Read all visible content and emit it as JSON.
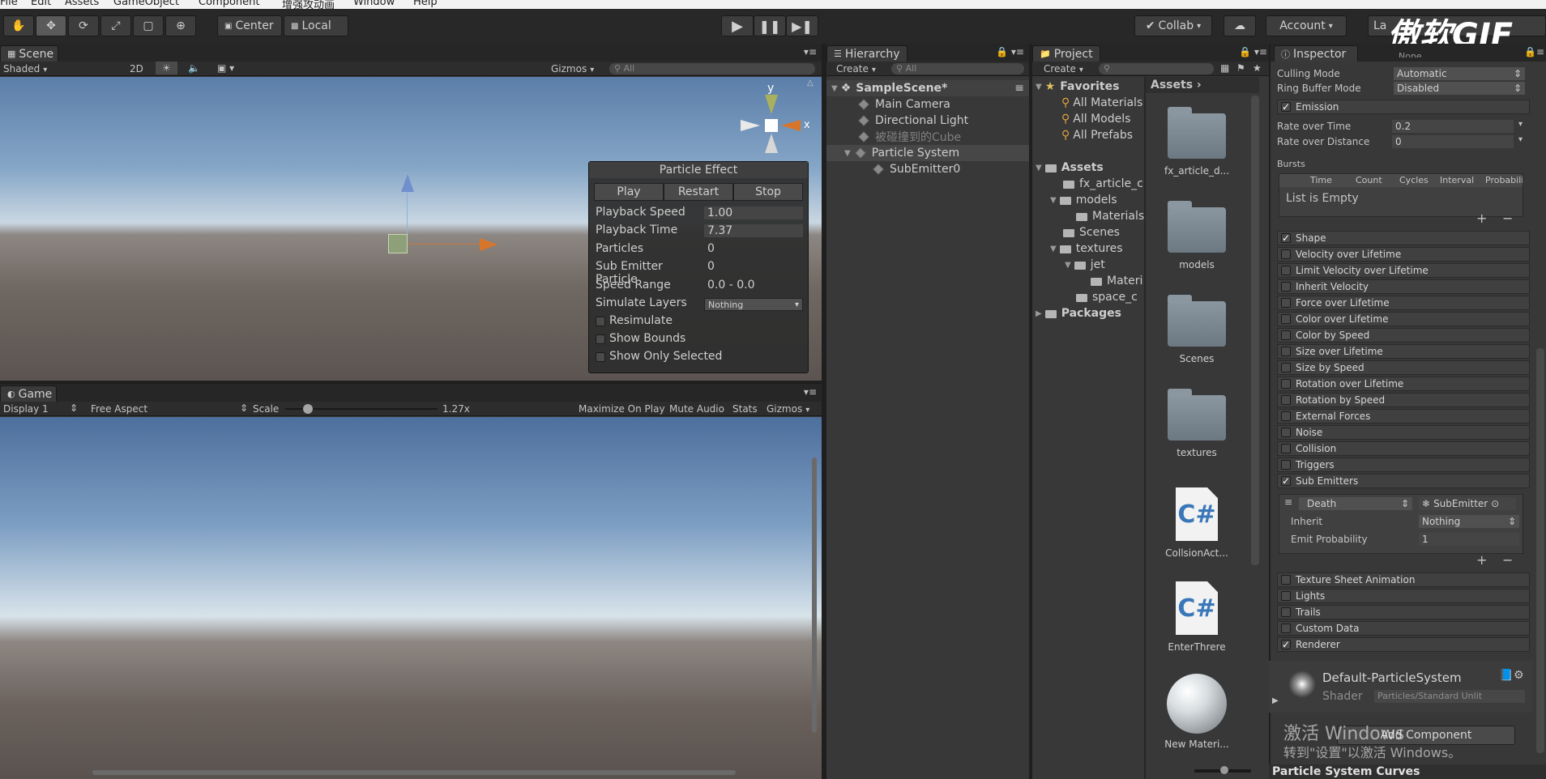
{
  "menu": [
    "File",
    "Edit",
    "Assets",
    "GameObject",
    "Component",
    "增强攻动画",
    "Window",
    "Help"
  ],
  "toolbar": {
    "pivot": "Center",
    "space": "Local",
    "collab": "Collab",
    "account": "Account",
    "layers": "La"
  },
  "watermark": "傲软GIF",
  "scene": {
    "tab": "Scene",
    "shading": "Shaded",
    "mode2d": "2D",
    "gizmos": "Gizmos",
    "search_placeholder": "All",
    "axis_y": "y",
    "axis_x": "x"
  },
  "particle_effect": {
    "title": "Particle Effect",
    "play": "Play",
    "restart": "Restart",
    "stop": "Stop",
    "rows": [
      {
        "label": "Playback Speed",
        "value": "1.00"
      },
      {
        "label": "Playback Time",
        "value": "7.37"
      },
      {
        "label": "Particles",
        "value": "0"
      },
      {
        "label": "Sub Emitter Particle",
        "value": "0"
      },
      {
        "label": "Speed Range",
        "value": "0.0 - 0.0"
      }
    ],
    "simulate_label": "Simulate Layers",
    "simulate_value": "Nothing",
    "resimulate": "Resimulate",
    "show_bounds": "Show Bounds",
    "show_only_selected": "Show Only Selected"
  },
  "game": {
    "tab": "Game",
    "display": "Display 1",
    "aspect": "Free Aspect",
    "scale_label": "Scale",
    "scale_value": "1.27x",
    "scale_fraction": 0.15,
    "maximize": "Maximize On Play",
    "mute": "Mute Audio",
    "stats": "Stats",
    "gizmos": "Gizmos"
  },
  "hierarchy": {
    "tab": "Hierarchy",
    "create": "Create",
    "search_placeholder": "All",
    "scene": "SampleScene*",
    "items": [
      "Main Camera",
      "Directional Light",
      "被碰撞到的Cube",
      "Particle System",
      "SubEmitter0"
    ]
  },
  "project": {
    "tab": "Project",
    "create": "Create",
    "favorites": "Favorites",
    "fav_items": [
      "All Materials",
      "All Models",
      "All Prefabs"
    ],
    "assets_root": "Assets",
    "tree": [
      "fx_article_c",
      "models",
      "Materials",
      "Scenes",
      "textures",
      "jet",
      "Materi",
      "space_c"
    ],
    "packages": "Packages",
    "breadcrumb": "Assets",
    "grid": [
      "fx_article_d...",
      "models",
      "Scenes",
      "textures",
      "CollsionAct...",
      "EnterThrere",
      "New Materi..."
    ],
    "cs_glyph": "C#"
  },
  "inspector": {
    "tab": "Inspector",
    "top_cut": "None",
    "culling_label": "Culling Mode",
    "culling_value": "Automatic",
    "ring_label": "Ring Buffer Mode",
    "ring_value": "Disabled",
    "emission": "Emission",
    "rot_label": "Rate over Time",
    "rot_value": "0.2",
    "rod_label": "Rate over Distance",
    "rod_value": "0",
    "bursts": "Bursts",
    "burst_cols": [
      "Time",
      "Count",
      "Cycles",
      "Interval",
      "Probabilit"
    ],
    "list_empty": "List is Empty",
    "plus": "+",
    "minus": "−",
    "modules": [
      {
        "name": "Shape",
        "on": true
      },
      {
        "name": "Velocity over Lifetime",
        "on": false
      },
      {
        "name": "Limit Velocity over Lifetime",
        "on": false
      },
      {
        "name": "Inherit Velocity",
        "on": false
      },
      {
        "name": "Force over Lifetime",
        "on": false
      },
      {
        "name": "Color over Lifetime",
        "on": false
      },
      {
        "name": "Color by Speed",
        "on": false
      },
      {
        "name": "Size over Lifetime",
        "on": false
      },
      {
        "name": "Size by Speed",
        "on": false
      },
      {
        "name": "Rotation over Lifetime",
        "on": false
      },
      {
        "name": "Rotation by Speed",
        "on": false
      },
      {
        "name": "External Forces",
        "on": false
      },
      {
        "name": "Noise",
        "on": false
      },
      {
        "name": "Collision",
        "on": false
      },
      {
        "name": "Triggers",
        "on": false
      },
      {
        "name": "Sub Emitters",
        "on": true
      }
    ],
    "sub_type": "Death",
    "sub_emitter": "SubEmitter",
    "inherit_label": "Inherit",
    "inherit_value": "Nothing",
    "emit_prob_label": "Emit Probability",
    "emit_prob_value": "1",
    "modules2": [
      {
        "name": "Texture Sheet Animation",
        "on": false
      },
      {
        "name": "Lights",
        "on": false
      },
      {
        "name": "Trails",
        "on": false
      },
      {
        "name": "Custom Data",
        "on": false
      },
      {
        "name": "Renderer",
        "on": true
      }
    ],
    "material": "Default-ParticleSystem",
    "shader_label": "Shader",
    "shader_value": "Particles/Standard Unlit",
    "add_component": "Add Component",
    "curves": "Particle System Curves"
  },
  "activation": {
    "line1": "激活 Windows",
    "line2": "转到\"设置\"以激活 Windows。"
  }
}
